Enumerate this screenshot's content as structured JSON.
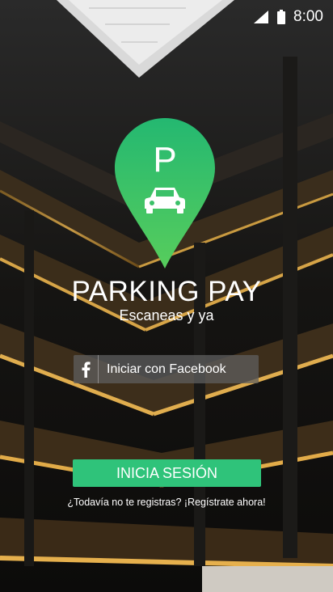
{
  "status_bar": {
    "time": "8:00"
  },
  "logo": {
    "letter": "P"
  },
  "app": {
    "title": "PARKING PAY",
    "subtitle": "Escaneas y ya"
  },
  "facebook_button": {
    "label": "Iniciar con Facebook",
    "icon": "facebook-icon"
  },
  "login_button": {
    "label": "INICIA SESIÓN"
  },
  "register_link": {
    "text": "¿Todavía no te registras? ¡Regístrate ahora!"
  },
  "colors": {
    "accent_green": "#2fc37a",
    "pin_green_top": "#24b871",
    "pin_green_bottom": "#52cc5f"
  }
}
